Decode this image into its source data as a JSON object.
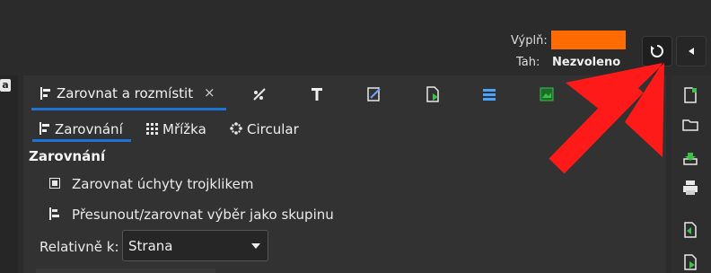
{
  "style_indicator": {
    "fill_label": "Výplň:",
    "stroke_label": "Tah:",
    "stroke_value": "Nezvoleno",
    "fill_color": "#ff6b00"
  },
  "left_marker": "a",
  "panel": {
    "active_tab_label": "Zarovnat a rozmístit",
    "close_glyph": "×",
    "tab_icons": [
      "gradient-icon",
      "text-icon",
      "edit-icon",
      "export-icon",
      "layers-icon",
      "image-icon",
      "object-icon"
    ],
    "subtabs": [
      {
        "label": "Zarovnání"
      },
      {
        "label": "Mřížka"
      },
      {
        "label": "Circular"
      }
    ],
    "heading": "Zarovnání",
    "options": [
      {
        "label": "Zarovnat úchyty trojklikem"
      },
      {
        "label": "Přesunout/zarovnat výběr jako skupinu"
      }
    ],
    "relative_label": "Relativně k:",
    "relative_value": "Strana"
  },
  "annotation": {
    "color": "#ff1a1a"
  }
}
